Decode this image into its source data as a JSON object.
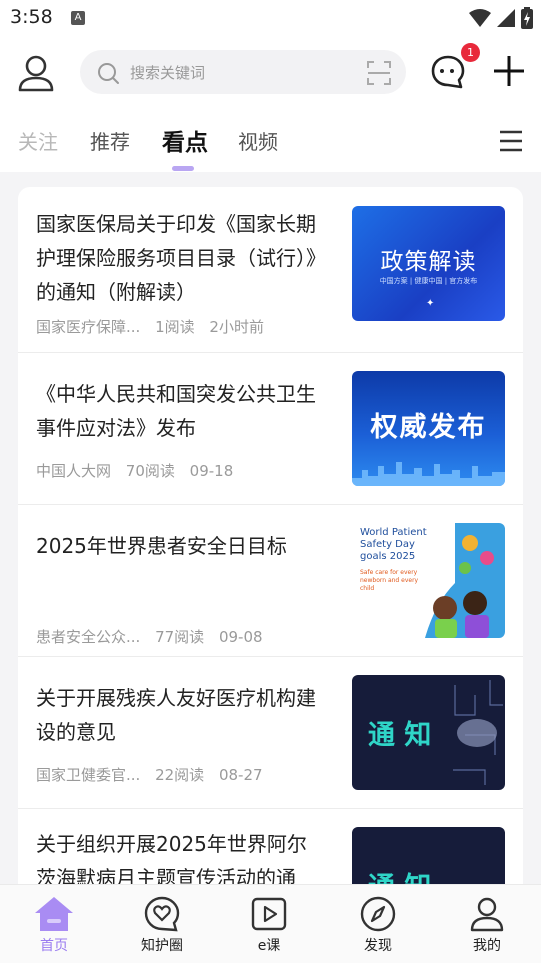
{
  "status": {
    "time": "3:58",
    "a_icon": "A"
  },
  "header": {
    "search_placeholder": "搜索关键词",
    "message_badge": "1"
  },
  "tabs": [
    "关注",
    "推荐",
    "看点",
    "视频"
  ],
  "active_tab": "看点",
  "feed": [
    {
      "title": "国家医保局关于印发《国家长期护理保险服务项目目录（试行）》的通知（附解读）",
      "source": "国家医疗保障...",
      "reads": "1阅读",
      "time": "2小时前",
      "thumb": {
        "caption": "政策解读",
        "sub": "中国方案 | 健康中国 | 官方发布"
      }
    },
    {
      "title": "《中华人民共和国突发公共卫生事件应对法》发布",
      "source": "中国人大网",
      "reads": "70阅读",
      "time": "09-18",
      "thumb": {
        "caption": "权威发布"
      }
    },
    {
      "title": "2025年世界患者安全日目标",
      "source": "患者安全公众...",
      "reads": "77阅读",
      "time": "09-08",
      "thumb": {
        "caption": "World Patient Safety Day goals 2025",
        "sub": "Safe care for every newborn and every child"
      }
    },
    {
      "title": "关于开展残疾人友好医疗机构建设的意见",
      "source": "国家卫健委官...",
      "reads": "22阅读",
      "time": "08-27",
      "thumb": {
        "caption": "通 知"
      }
    },
    {
      "title": "关于组织开展2025年世界阿尔茨海默病月主题宣传活动的通",
      "thumb": {
        "caption": "通 知"
      }
    }
  ],
  "bottom_nav": [
    {
      "label": "首页",
      "icon": "home-icon",
      "active": true
    },
    {
      "label": "知护圈",
      "icon": "heart-bubble-icon"
    },
    {
      "label": "e课",
      "icon": "video-play-icon"
    },
    {
      "label": "发现",
      "icon": "compass-icon"
    },
    {
      "label": "我的",
      "icon": "user-icon"
    }
  ],
  "colors": {
    "accent": "#9a7cf0",
    "badge": "#e8293b",
    "indicator": "#b9a6f2"
  }
}
